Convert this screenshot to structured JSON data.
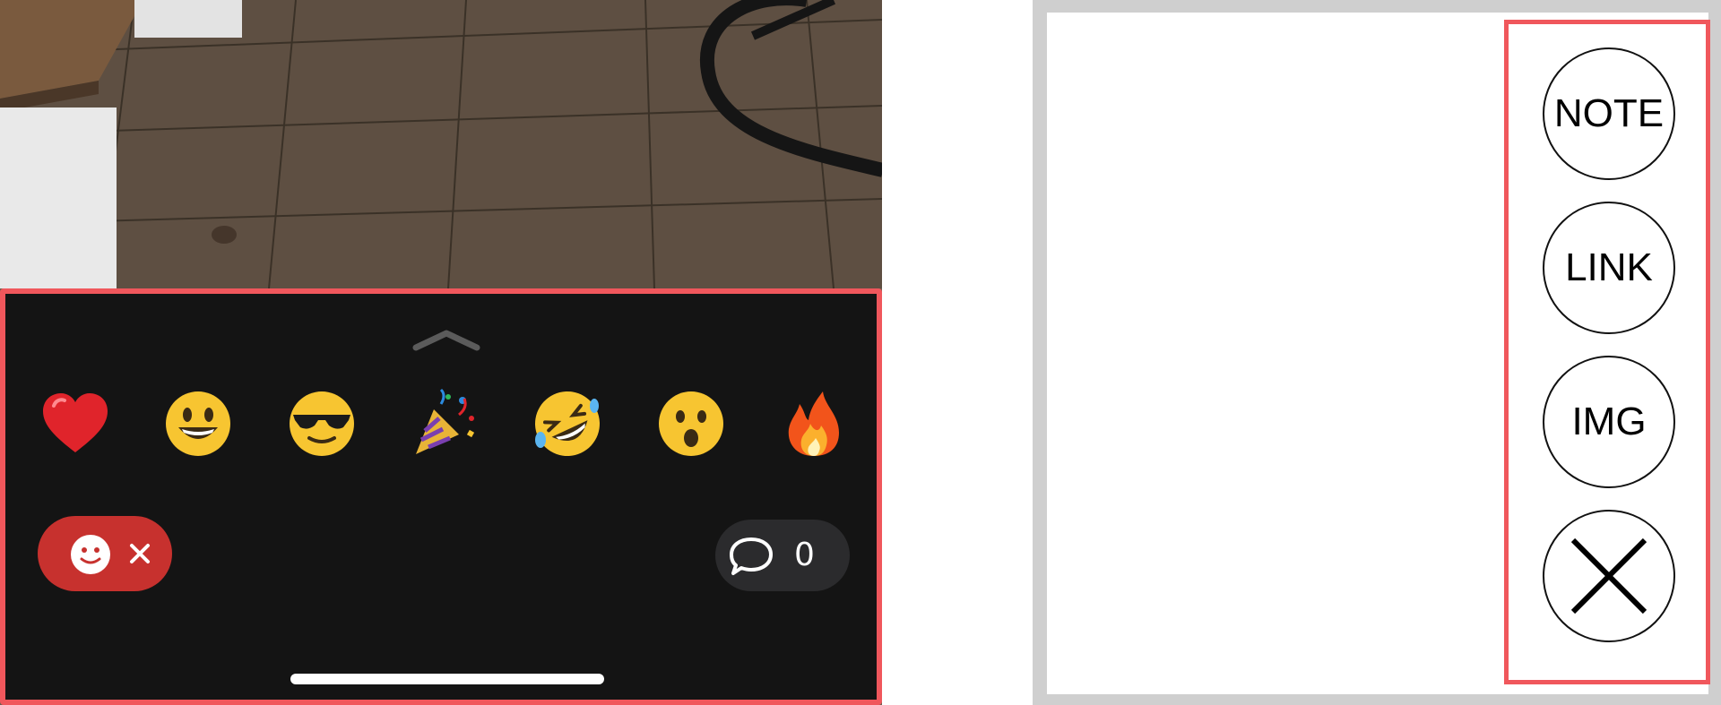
{
  "colors": {
    "highlight_border": "#f0575c",
    "sheet_bg": "#141414",
    "toggle_bg": "#c7312e",
    "comment_bg": "#2b2b2d"
  },
  "reaction_sheet": {
    "expand_icon": "chevron-up-icon",
    "reactions": [
      {
        "name": "red-heart",
        "glyph": "❤️"
      },
      {
        "name": "grinning-face",
        "glyph": "😃"
      },
      {
        "name": "sunglasses-face",
        "glyph": "😎"
      },
      {
        "name": "party-popper",
        "glyph": "🎉"
      },
      {
        "name": "rolling-laughing-face",
        "glyph": "🤣"
      },
      {
        "name": "surprised-face",
        "glyph": "😮"
      },
      {
        "name": "fire",
        "glyph": "🔥"
      }
    ],
    "reactions_toggle": {
      "icon": "smiley-icon",
      "close_icon": "close-x-icon"
    },
    "comments": {
      "icon": "speech-bubble-icon",
      "count": "0"
    }
  },
  "tool_panel": {
    "buttons": {
      "note": "NOTE",
      "link": "LINK",
      "img": "IMG",
      "close_icon": "close-x-icon"
    }
  }
}
